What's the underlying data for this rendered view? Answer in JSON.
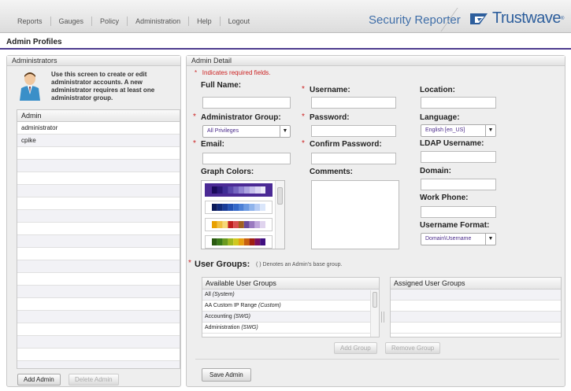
{
  "nav": {
    "items": [
      "Reports",
      "Gauges",
      "Policy",
      "Administration",
      "Help",
      "Logout"
    ],
    "product": "Security Reporter",
    "brand": "Trustwave",
    "brand_mark": "®"
  },
  "page": {
    "title": "Admin Profiles"
  },
  "administrators": {
    "header": "Administrators",
    "intro": "Use this screen to create or edit administrator accounts. A new administrator requires at least one administrator group.",
    "list_header": "Admin",
    "rows": [
      "administrator",
      "cpike"
    ],
    "add_label": "Add Admin",
    "delete_label": "Delete Admin"
  },
  "detail": {
    "header": "Admin Detail",
    "required_note": "Indicates required fields.",
    "full_name": "Full Name:",
    "username": "Username:",
    "location": "Location:",
    "admin_group": "Administrator Group:",
    "admin_group_value": "All Privileges",
    "password": "Password:",
    "language": "Language:",
    "language_value": "English [en_US]",
    "email": "Email:",
    "confirm_password": "Confirm Password:",
    "ldap_username": "LDAP Username:",
    "graph_colors": "Graph Colors:",
    "comments": "Comments:",
    "domain": "Domain:",
    "work_phone": "Work Phone:",
    "username_format": "Username Format:",
    "username_format_value": "Domain\\Username",
    "user_groups": "User Groups:",
    "user_groups_note": "( ) Denotes an Admin's base group.",
    "available_header": "Available User Groups",
    "assigned_header": "Assigned User Groups",
    "available_rows": [
      {
        "name": "All",
        "suffix": "(System)"
      },
      {
        "name": "AA Custom IP Range",
        "suffix": "(Custom)"
      },
      {
        "name": "Accounting",
        "suffix": "(SWG)"
      },
      {
        "name": "Administration",
        "suffix": "(SWG)"
      }
    ],
    "add_group": "Add Group",
    "remove_group": "Remove Group",
    "save_admin": "Save Admin"
  },
  "colors": {
    "accent": "#4d3c8f",
    "required": "#cc2222",
    "brand": "#2d5e9c"
  }
}
